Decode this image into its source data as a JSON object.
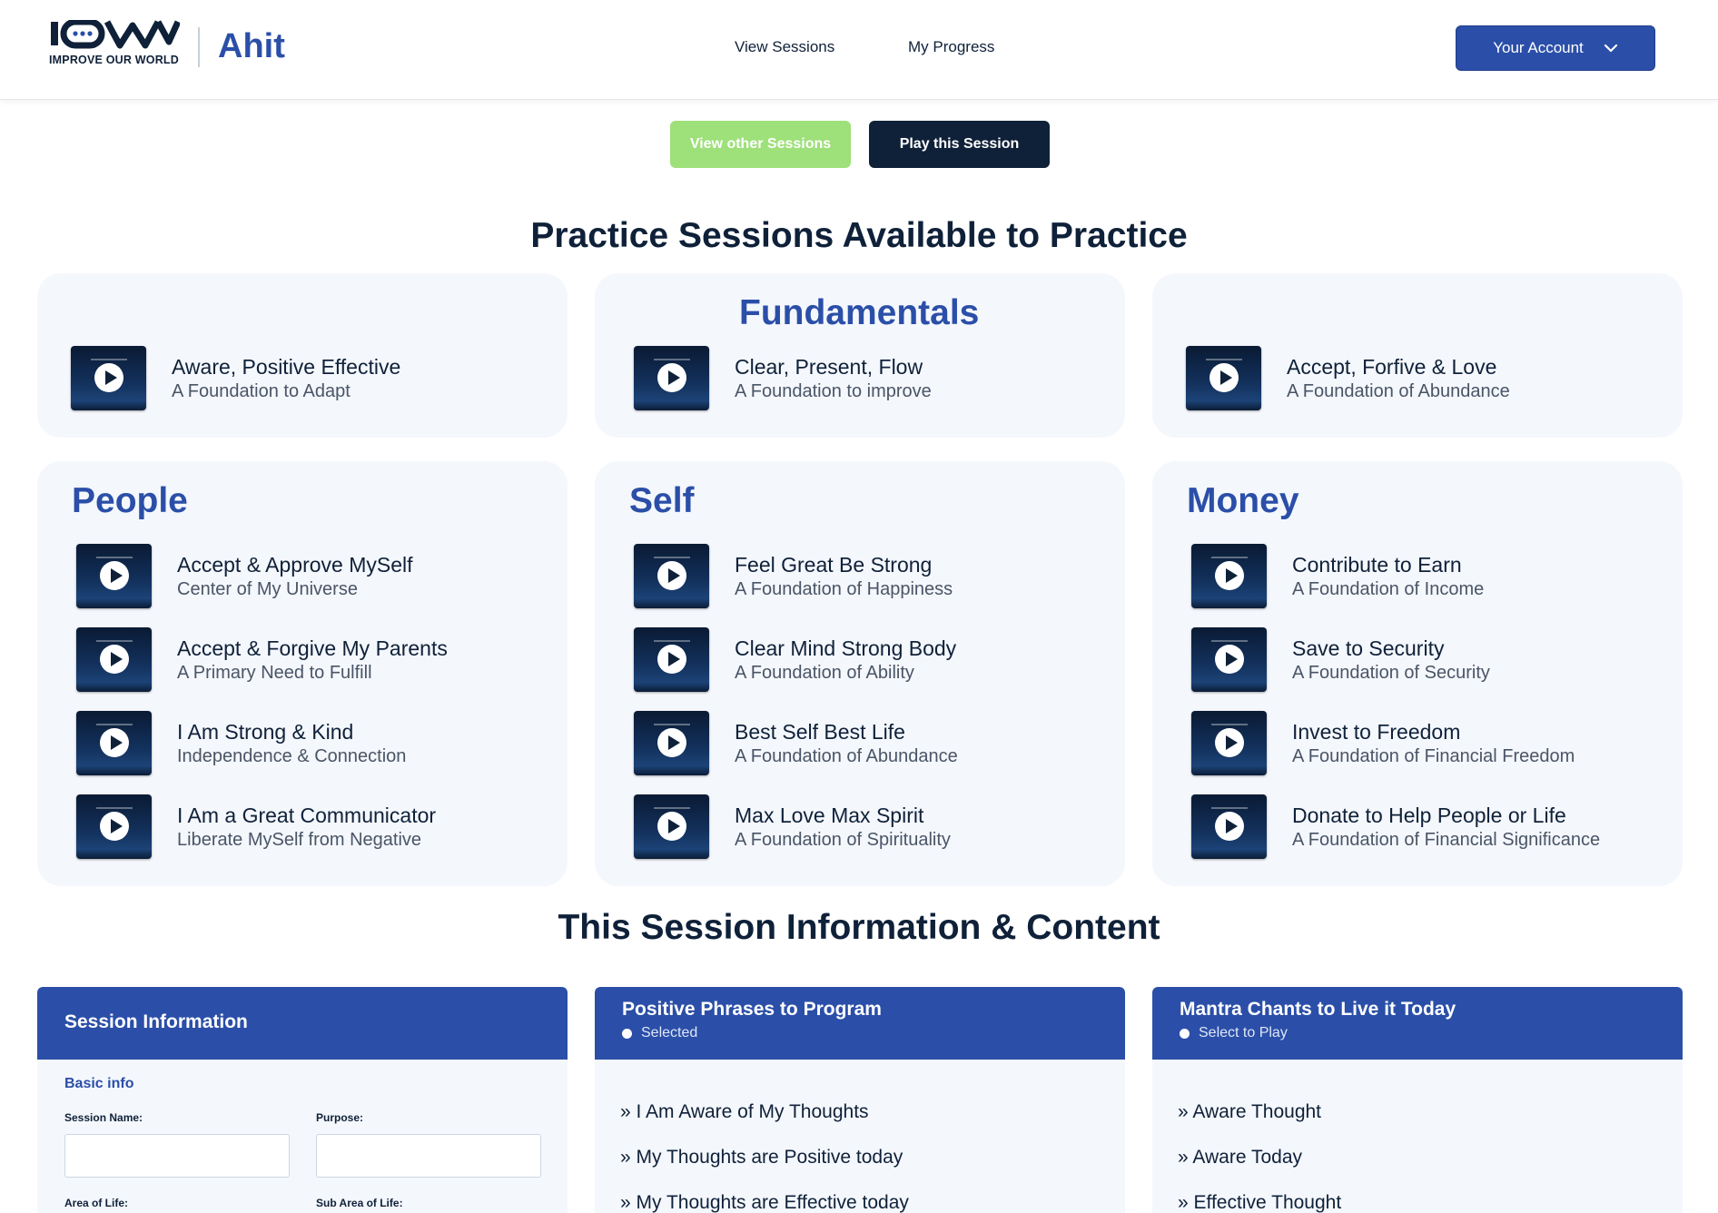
{
  "header": {
    "logo_tag": "IMPROVE OUR WORLD",
    "brand_name": "Ahit",
    "nav": [
      "View Sessions",
      "My Progress"
    ],
    "account_label": "Your Account"
  },
  "actions": {
    "view_other": "View other Sessions",
    "play": "Play this Session"
  },
  "practice_title": "Practice Sessions Available to Practice",
  "fundamentals": {
    "title": "Fundamentals",
    "items": [
      {
        "title": "Aware, Positive Effective",
        "sub": "A Foundation to Adapt"
      },
      {
        "title": "Clear, Present, Flow",
        "sub": "A Foundation to improve"
      },
      {
        "title": "Accept, Forfive & Love",
        "sub": "A Foundation of Abundance"
      }
    ]
  },
  "categories": [
    {
      "title": "People",
      "items": [
        {
          "title": "Accept & Approve MySelf",
          "sub": "Center of My Universe"
        },
        {
          "title": "Accept & Forgive My Parents",
          "sub": "A Primary Need to Fulfill"
        },
        {
          "title": "I Am Strong & Kind",
          "sub": "Independence & Connection"
        },
        {
          "title": "I Am a Great Communicator",
          "sub": "Liberate MySelf from Negative"
        }
      ]
    },
    {
      "title": "Self",
      "items": [
        {
          "title": "Feel Great Be Strong",
          "sub": "A Foundation of Happiness"
        },
        {
          "title": "Clear Mind Strong Body",
          "sub": "A Foundation of Ability"
        },
        {
          "title": "Best Self Best Life",
          "sub": "A Foundation of Abundance"
        },
        {
          "title": "Max Love Max Spirit",
          "sub": "A Foundation of Spirituality"
        }
      ]
    },
    {
      "title": "Money",
      "items": [
        {
          "title": "Contribute to Earn",
          "sub": "A Foundation of Income"
        },
        {
          "title": "Save to Security",
          "sub": "A Foundation of Security"
        },
        {
          "title": "Invest to Freedom",
          "sub": "A Foundation of Financial Freedom"
        },
        {
          "title": "Donate to Help People or Life",
          "sub": "A Foundation of Financial Significance"
        }
      ]
    }
  ],
  "info_title": "This Session Information & Content",
  "session_info": {
    "title": "Session Information",
    "basic_info": "Basic info",
    "fields": [
      "Session Name:",
      "Purpose:",
      "Area of Life:",
      "Sub Area of Life:"
    ]
  },
  "phrases": {
    "title": "Positive Phrases to Program",
    "sub": "Selected",
    "items": [
      "» I Am Aware of My Thoughts",
      "» My Thoughts are Positive today",
      "» My Thoughts are Effective today"
    ]
  },
  "mantras": {
    "title": "Mantra Chants to Live it Today",
    "sub": "Select to Play",
    "items": [
      "» Aware Thought",
      "» Aware Today",
      "» Effective Thought"
    ]
  },
  "colors": {
    "brand_blue": "#2b4fa8",
    "navy": "#0f2139",
    "green": "#9ee07a",
    "card_bg": "#f4f7fc"
  }
}
